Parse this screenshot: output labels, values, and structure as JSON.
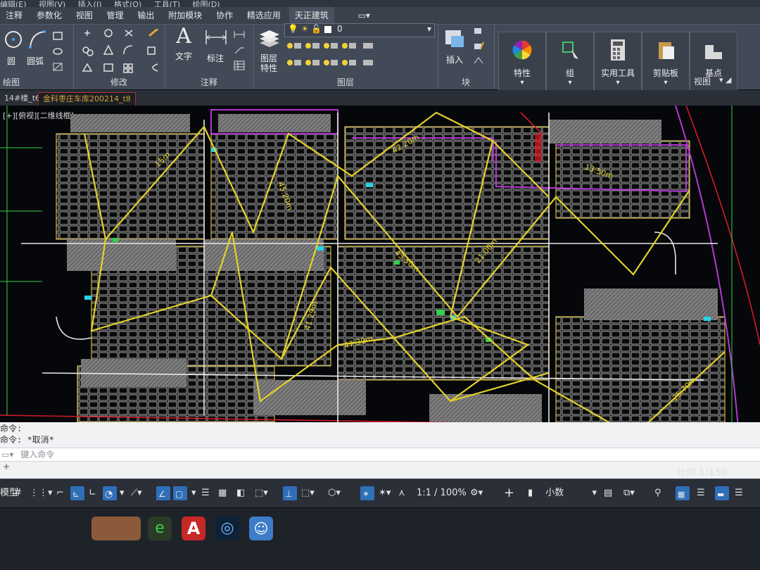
{
  "menubar": [
    "编辑(E)",
    "视图(V)",
    "插入(I)",
    "格式(O)",
    "工具(T)",
    "绘图(D)"
  ],
  "ribbon_tabs": [
    "注释",
    "参数化",
    "视图",
    "管理",
    "输出",
    "附加模块",
    "协作",
    "精选应用",
    "天正建筑"
  ],
  "ribbon": {
    "draw": {
      "labels": [
        "圆",
        "圆弧"
      ],
      "title": "绘图"
    },
    "modify": {
      "title": "修改"
    },
    "annotation": {
      "text": "文字",
      "dim": "标注",
      "title": "注释"
    },
    "layers": {
      "props": "图层\n特性",
      "title": "图层",
      "current_layer": "0"
    },
    "block": {
      "insert": "插入",
      "title": "块"
    },
    "properties": "特性",
    "group": "组",
    "utilities": "实用工具",
    "clipboard": "剪贴板",
    "base": "基点",
    "view_title": "视图"
  },
  "doc_tabs": [
    {
      "label": "14#楼_t6"
    },
    {
      "label": "金科枣庄车库200214_t8"
    }
  ],
  "canvas": {
    "view_label": "[+][俯视][二维线框]",
    "dimension_labels": [
      "15m",
      "45.20m",
      "42.20m",
      "13.50m",
      "41.29m",
      "43.50m",
      "21.00m",
      "47.30m",
      "25.70m"
    ]
  },
  "command": {
    "line1": "命令:",
    "line2": "命令: *取消*",
    "placeholder": "键入命令"
  },
  "status": {
    "model": "模型",
    "zoom": "1:1 / 100%",
    "units": "小数",
    "scale": "比例 1:150"
  },
  "colors": {
    "yellow_lines": "#e3d12a",
    "magenta": "#b537d4",
    "red": "#d41a2a",
    "cyan": "#23d5e8",
    "green": "#33d24a",
    "gray_hatch": "#7a7a7a"
  },
  "taskbar_apps": [
    "file-explorer",
    "360-browser",
    "autocad",
    "media-player",
    "qq"
  ]
}
